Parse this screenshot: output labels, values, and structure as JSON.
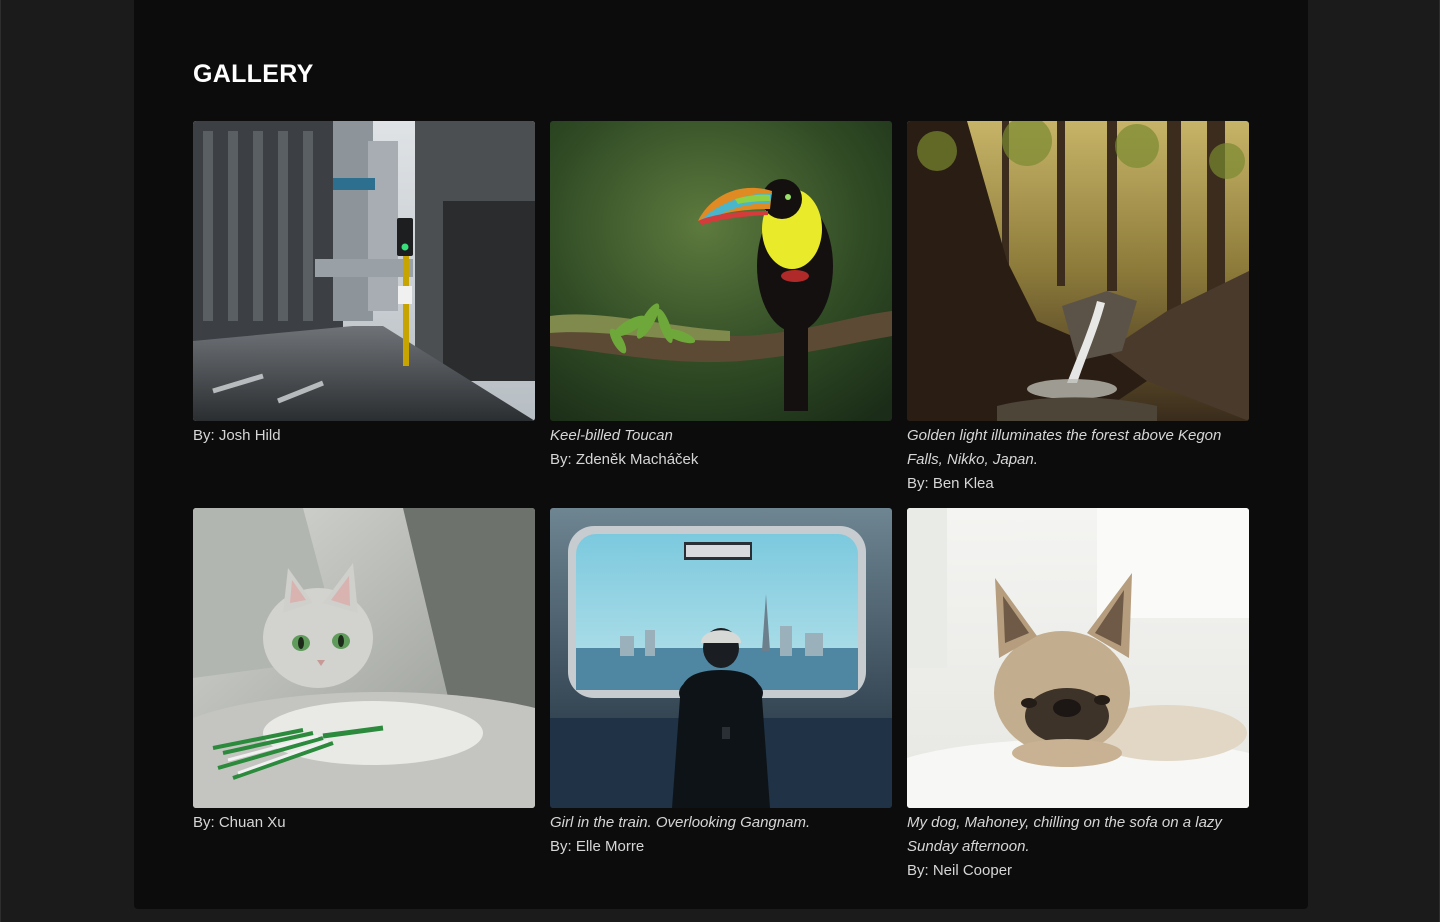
{
  "gallery": {
    "title": "GALLERY",
    "items": [
      {
        "description": "",
        "credit": "By: Josh Hild",
        "image": "city-street-photo"
      },
      {
        "description": "Keel-billed Toucan",
        "credit": "By: Zdeněk Macháček",
        "image": "toucan-photo"
      },
      {
        "description": "Golden light illuminates the forest above Kegon Falls, Nikko, Japan.",
        "credit": "By: Ben Klea",
        "image": "waterfall-forest-photo"
      },
      {
        "description": "",
        "credit": "By: Chuan Xu",
        "image": "cat-photo"
      },
      {
        "description": "Girl in the train. Overlooking Gangnam.",
        "credit": "By: Elle Morre",
        "image": "train-window-photo"
      },
      {
        "description": "My dog, Mahoney, chilling on the sofa on a lazy Sunday afternoon.",
        "credit": "By: Neil Cooper",
        "image": "french-bulldog-photo"
      }
    ]
  }
}
